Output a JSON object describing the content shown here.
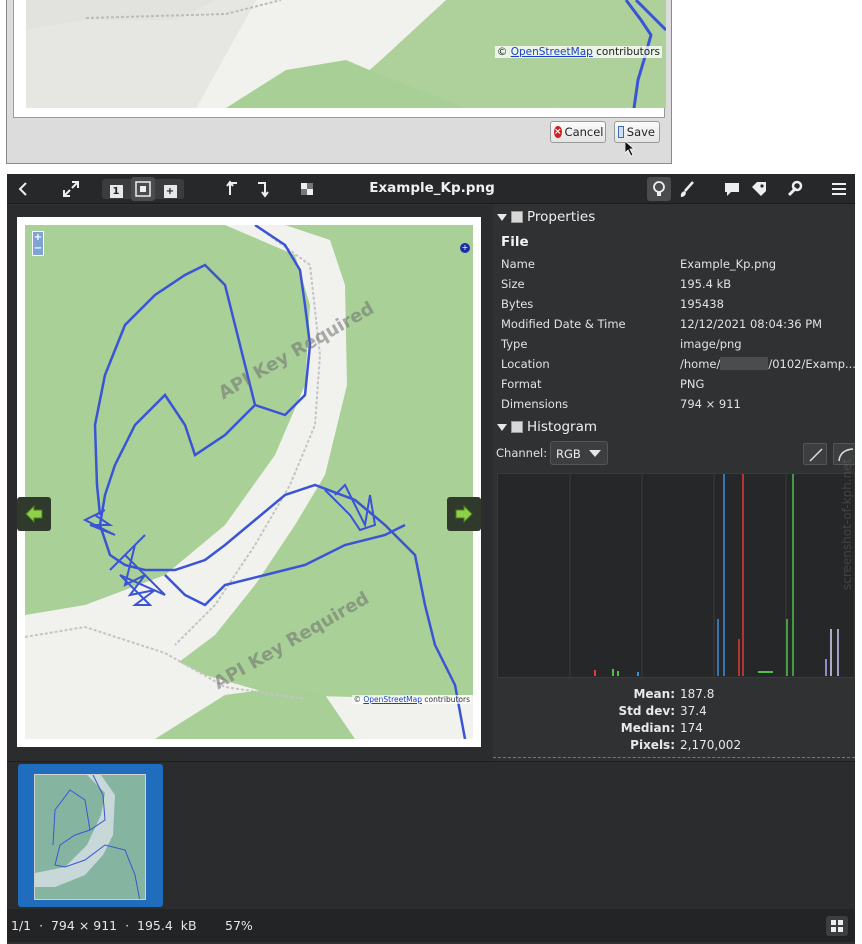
{
  "dialog": {
    "attribution_prefix": "©",
    "attribution_link": "OpenStreetMap",
    "attribution_suffix": "contributors",
    "cancel_label": "Cancel",
    "save_label": "Save"
  },
  "viewer": {
    "title": "Example_Kp.png",
    "toolbar": {
      "back_icon": "chevron-left-icon",
      "fullscreen_icon": "expand-icon",
      "view_modes": [
        "1",
        "grid",
        "+"
      ],
      "rotate_left_icon": "rotate-left-icon",
      "rotate_right_icon": "rotate-right-icon",
      "checker_icon": "checkerboard-icon",
      "right_icons": [
        "lightbulb-icon",
        "brush-icon",
        "comment-icon",
        "tag-icon",
        "wrench-icon",
        "menu-icon"
      ]
    },
    "image": {
      "watermark_1": "API Key Required",
      "watermark_2": "API Key Required",
      "zoom_in": "+",
      "zoom_out": "−",
      "attribution_prefix": "©",
      "attribution_link": "OpenStreetMap",
      "attribution_suffix": "contributors"
    },
    "properties": {
      "header": "Properties",
      "file_heading": "File",
      "rows": [
        {
          "key": "Name",
          "value": "Example_Kp.png"
        },
        {
          "key": "Size",
          "value": "195.4  kB"
        },
        {
          "key": "Bytes",
          "value": "195438"
        },
        {
          "key": "Modified Date & Time",
          "value": "12/12/2021 08:04:36 PM"
        },
        {
          "key": "Type",
          "value": "image/png"
        },
        {
          "key": "Location",
          "value_prefix": "/home/",
          "value_suffix": "/0102/Examp..."
        },
        {
          "key": "Format",
          "value": "PNG"
        },
        {
          "key": "Dimensions",
          "value": "794 × 911"
        }
      ]
    },
    "histogram": {
      "header": "Histogram",
      "channel_label": "Channel:",
      "channel_value": "RGB",
      "stats": [
        {
          "key": "Mean:",
          "value": "187.8"
        },
        {
          "key": "Std dev:",
          "value": "37.4"
        },
        {
          "key": "Median:",
          "value": "174"
        },
        {
          "key": "Pixels:",
          "value": "2,170,002"
        }
      ],
      "colors": {
        "red": "#e03a3a",
        "green": "#4ec04a",
        "blue": "#3f8fe0",
        "white": "#d8d8ff"
      }
    },
    "status": {
      "text": "1/1  ·  794 × 911  ·  195.4  kB",
      "zoom": "57%"
    },
    "side_watermark": "screenshot-of-kph.net"
  },
  "colors": {
    "map_green": "#aed19b",
    "road": "#f2f2ef",
    "track": "#3b54d6",
    "selection": "#1f6dbc"
  }
}
